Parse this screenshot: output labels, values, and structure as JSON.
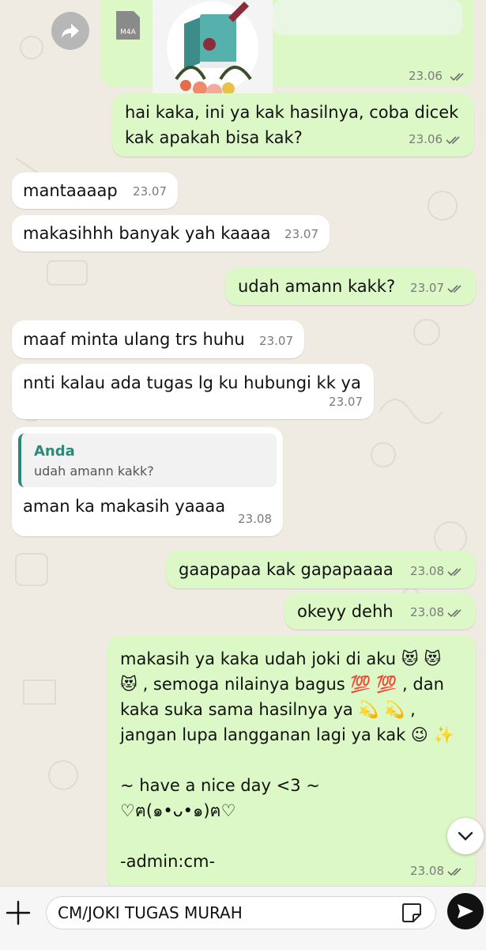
{
  "chat": {
    "file_message": {
      "file_type": "M4A",
      "time": "23.06",
      "status": "read"
    },
    "messages": [
      {
        "dir": "out",
        "text": "hai kaka, ini ya kak hasilnya, coba dicek\nkak apakah bisa kak?",
        "time": "23.06",
        "status": "read"
      },
      {
        "dir": "in",
        "text": "mantaaaap",
        "time": "23.07"
      },
      {
        "dir": "in",
        "text": "makasihhh banyak yah kaaaa",
        "time": "23.07"
      },
      {
        "dir": "out",
        "text": "udah amann kakk?",
        "time": "23.07",
        "status": "read"
      },
      {
        "dir": "in",
        "text": "maaf minta ulang trs huhu",
        "time": "23.07"
      },
      {
        "dir": "in",
        "text": "nnti kalau ada tugas lg ku hubungi kk ya",
        "time": "23.07"
      },
      {
        "dir": "in",
        "text": "aman ka makasih yaaaa",
        "time": "23.08",
        "quote": {
          "name": "Anda",
          "text": "udah amann kakk?"
        }
      },
      {
        "dir": "out",
        "text": "gaapapaa kak gapapaaaa",
        "time": "23.08",
        "status": "read"
      },
      {
        "dir": "out",
        "text": "okeyy dehh",
        "time": "23.08",
        "status": "read"
      },
      {
        "dir": "out",
        "text": "makasih ya kaka udah joki di aku 😻 😻\n😻 , semoga nilainya bagus 💯 💯 , dan\nkaka suka sama hasilnya ya 💫 💫 ,\njangan lupa langganan lagi ya kak 😉 ✨\n\n~ have a nice day <3 ~\n♡ฅ(๑•ᴗ•๑)ฅ♡\n\n-admin:cm-",
        "time": "23.08",
        "status": "read"
      }
    ]
  },
  "composer": {
    "value": "CM/JOKI TUGAS MURAH"
  },
  "icons": {
    "forward": "forward-arrow-icon",
    "read_receipt": "double-check-icon",
    "scroll_down": "chevron-down-icon",
    "attach": "plus-icon",
    "sticker": "sticker-icon",
    "send": "send-icon"
  },
  "colors": {
    "incoming": "#ffffff",
    "outgoing": "#dcf8c6",
    "quote_accent": "#2a8a7a",
    "background": "#efeae2"
  }
}
